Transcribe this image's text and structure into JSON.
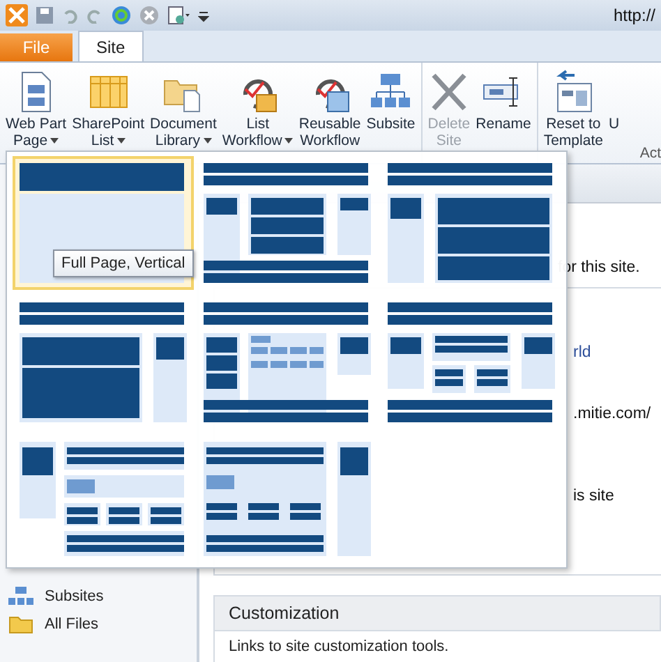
{
  "window": {
    "address": "http://"
  },
  "tabs": [
    {
      "label": "File",
      "kind": "file",
      "selected": false
    },
    {
      "label": "Site",
      "kind": "tab",
      "selected": true
    }
  ],
  "ribbon": {
    "groups": [
      {
        "buttons": [
          {
            "lines": [
              "Web Part",
              "Page"
            ],
            "dropdown": true,
            "disabled": false
          },
          {
            "lines": [
              "SharePoint",
              "List"
            ],
            "dropdown": true,
            "disabled": false
          },
          {
            "lines": [
              "Document",
              "Library"
            ],
            "dropdown": true,
            "disabled": false
          },
          {
            "lines": [
              "List",
              "Workflow"
            ],
            "dropdown": true,
            "disabled": false
          },
          {
            "lines": [
              "Reusable",
              "Workflow"
            ],
            "dropdown": false,
            "disabled": false
          },
          {
            "lines": [
              "Subsite"
            ],
            "dropdown": false,
            "disabled": false
          }
        ]
      },
      {
        "buttons": [
          {
            "lines": [
              "Delete",
              "Site"
            ],
            "dropdown": false,
            "disabled": true
          },
          {
            "lines": [
              "Rename"
            ],
            "dropdown": false,
            "disabled": false
          }
        ]
      },
      {
        "buttons": [
          {
            "lines": [
              "Reset to",
              "Template"
            ],
            "dropdown": false,
            "disabled": false
          },
          {
            "lines": [
              "U"
            ],
            "dropdown": false,
            "disabled": false
          }
        ]
      }
    ],
    "group_label": "Act"
  },
  "layout_picker": {
    "tooltip": "Full Page, Vertical",
    "layouts": [
      {
        "selected": true
      },
      {
        "selected": false
      },
      {
        "selected": false
      },
      {
        "selected": false
      },
      {
        "selected": false
      },
      {
        "selected": false
      },
      {
        "selected": false
      },
      {
        "selected": false
      }
    ]
  },
  "navigation": {
    "items": [
      {
        "label": "Subsites"
      },
      {
        "label": "All Files"
      }
    ]
  },
  "content": {
    "fragments": [
      {
        "text": "for this site.",
        "kind": "plain"
      },
      {
        "text": "rld",
        "kind": "link"
      },
      {
        "text": ".mitie.com/",
        "kind": "plain"
      },
      {
        "text": "is site",
        "kind": "plain"
      }
    ],
    "customization": {
      "title": "Customization",
      "description": "Links to site customization tools."
    }
  }
}
